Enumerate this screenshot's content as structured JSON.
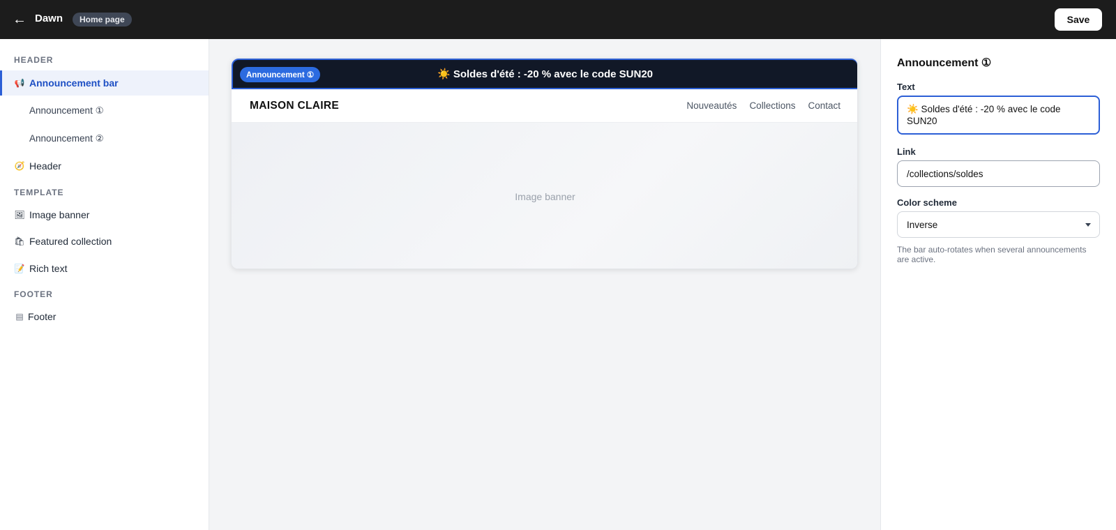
{
  "topbar": {
    "back_icon": "←",
    "theme_name": "Dawn",
    "page_selector": "Home page",
    "save_label": "Save"
  },
  "sidebar": {
    "sections": {
      "header": "HEADER",
      "template": "TEMPLATE",
      "footer": "FOOTER"
    },
    "items": [
      {
        "label": "Announcement bar",
        "icon": "megaphone-icon",
        "glyph": "📢",
        "active": true
      },
      {
        "label": "Announcement ①",
        "sub": true
      },
      {
        "label": "Announcement ②",
        "sub": true
      },
      {
        "label": "Header",
        "icon": "compass-icon",
        "glyph": "🧭"
      },
      {
        "label": "Image banner",
        "icon": "image-icon",
        "glyph": "🖼"
      },
      {
        "label": "Featured collection",
        "icon": "shopping-bags-icon",
        "glyph": "🛍"
      },
      {
        "label": "Rich text",
        "icon": "memo-icon",
        "glyph": "📝"
      },
      {
        "label": "Footer",
        "icon": "footer-layout-icon",
        "glyph": "▤"
      }
    ]
  },
  "preview": {
    "announcement_chip": "Announcement ①",
    "announcement_text": "☀️ Soldes d'été : -20 % avec le code SUN20",
    "store_name": "MAISON CLAIRE",
    "nav": [
      "Nouveautés",
      "Collections",
      "Contact"
    ],
    "banner_label": "Image banner",
    "accent_color": "#2c5fd6",
    "bar_color": "#111827"
  },
  "settings": {
    "title": "Announcement ①",
    "text_label": "Text",
    "text_value": "☀️ Soldes d'été : -20 % avec le code SUN20",
    "link_label": "Link",
    "link_value": "/collections/soldes",
    "color_scheme_label": "Color scheme",
    "color_scheme_value": "Inverse",
    "help_text": "The bar auto-rotates when several announcements are active."
  }
}
